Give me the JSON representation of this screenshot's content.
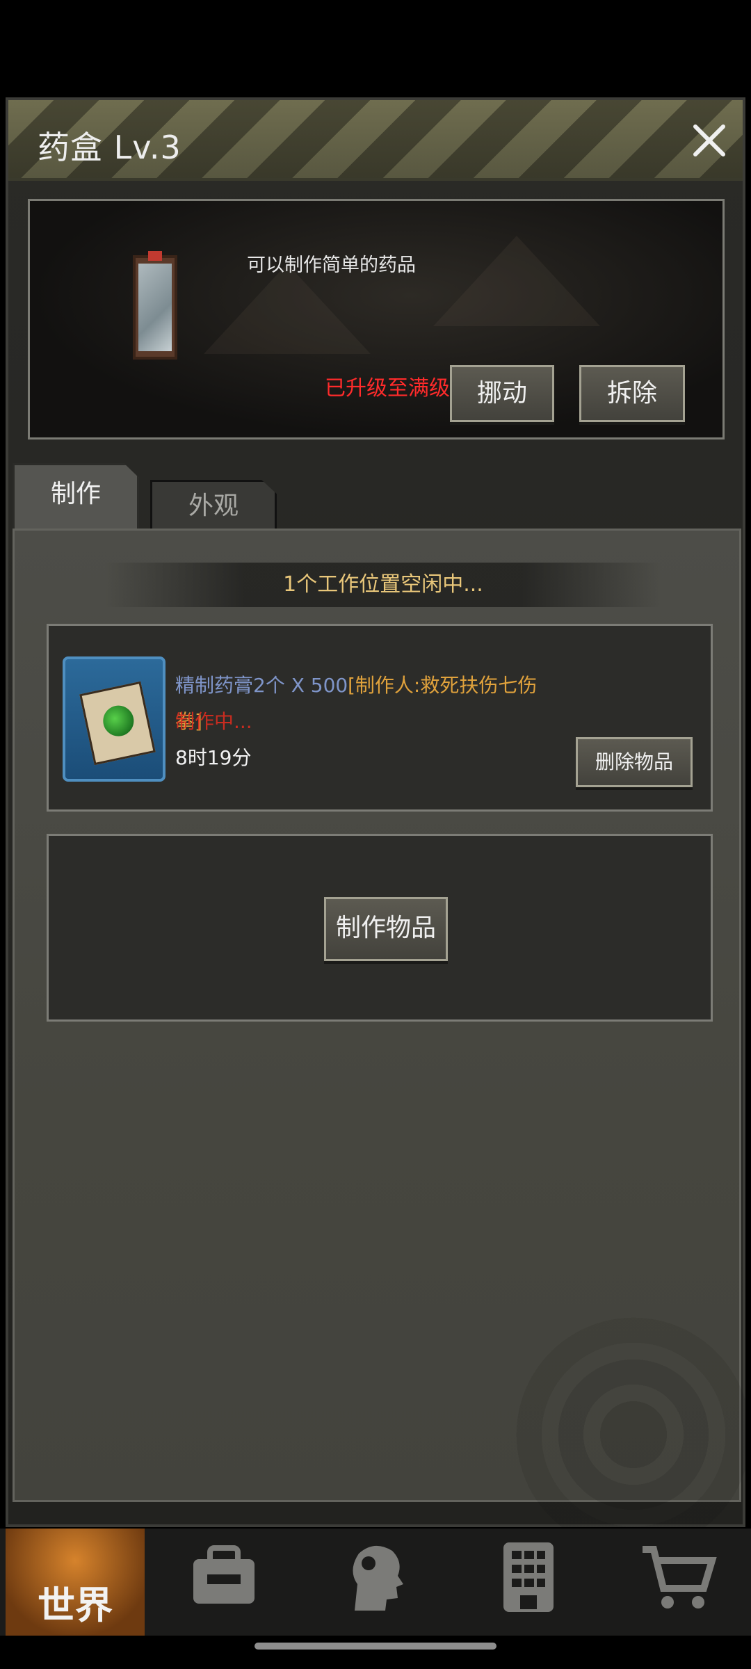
{
  "header": {
    "title": "药盒 Lv.3"
  },
  "info": {
    "description": "可以制作简单的药品",
    "max_level": "已升级至满级",
    "move_label": "挪动",
    "remove_label": "拆除"
  },
  "tabs": [
    {
      "label": "制作",
      "active": true
    },
    {
      "label": "外观",
      "active": false
    }
  ],
  "craft": {
    "slots_status": "1个工作位置空闲中...",
    "item_name": "精制药膏2个 X 500",
    "crafter": "[制作人:救死扶伤七伤",
    "crafter_cont": "拳]",
    "status": "制作中...",
    "time_left": "8时19分",
    "delete_label": "删除物品",
    "make_label": "制作物品"
  },
  "bottom_nav": {
    "world_label": "世界",
    "items": [
      "backpack-icon",
      "head-icon",
      "building-icon",
      "cart-icon"
    ]
  },
  "colors": {
    "accent_gold": "#e9c77a",
    "danger": "#ff2b2b",
    "item_blue": "#7f95c9",
    "crafter_orange": "#e0a23c"
  }
}
